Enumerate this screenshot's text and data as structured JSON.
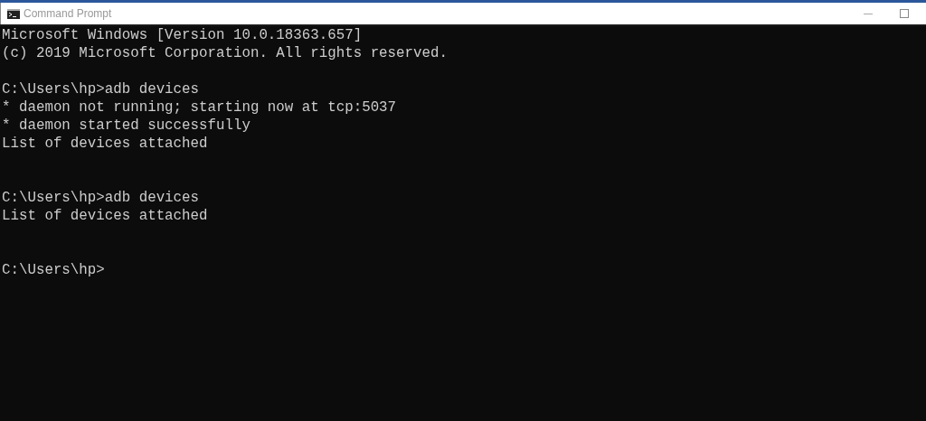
{
  "window": {
    "title": "Command Prompt"
  },
  "console": [
    {
      "kind": "text",
      "text": "Microsoft Windows [Version 10.0.18363.657]"
    },
    {
      "kind": "text",
      "text": "(c) 2019 Microsoft Corporation. All rights reserved."
    },
    {
      "kind": "blank"
    },
    {
      "kind": "text",
      "text": "C:\\Users\\hp>adb devices"
    },
    {
      "kind": "text",
      "text": "* daemon not running; starting now at tcp:5037"
    },
    {
      "kind": "text",
      "text": "* daemon started successfully"
    },
    {
      "kind": "text",
      "text": "List of devices attached"
    },
    {
      "kind": "blank"
    },
    {
      "kind": "blank"
    },
    {
      "kind": "text",
      "text": "C:\\Users\\hp>adb devices"
    },
    {
      "kind": "text",
      "text": "List of devices attached"
    },
    {
      "kind": "blank"
    },
    {
      "kind": "blank"
    },
    {
      "kind": "text",
      "text": "C:\\Users\\hp>"
    }
  ]
}
